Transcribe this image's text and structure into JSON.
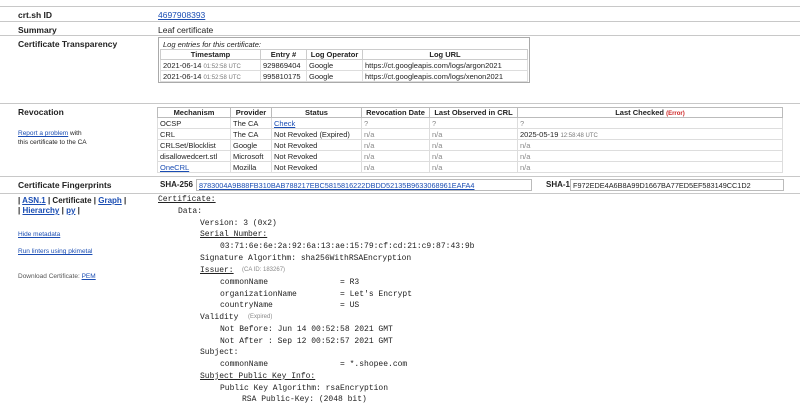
{
  "id_row": {
    "label": "crt.sh ID",
    "value": "4697908393"
  },
  "summary_row": {
    "label": "Summary",
    "value": "Leaf certificate"
  },
  "ct": {
    "label": "Certificate Transparency",
    "caption": "Log entries for this certificate:",
    "headers": [
      "Timestamp",
      "Entry #",
      "Log Operator",
      "Log URL"
    ],
    "rows": [
      {
        "date": "2021-06-14",
        "time": "01:52:58 UTC",
        "entry": "929869404",
        "operator": "Google",
        "url": "https://ct.googleapis.com/logs/argon2021"
      },
      {
        "date": "2021-06-14",
        "time": "01:52:58 UTC",
        "entry": "995810175",
        "operator": "Google",
        "url": "https://ct.googleapis.com/logs/xenon2021"
      }
    ]
  },
  "revocation": {
    "label": "Revocation",
    "report_link": "Report a problem",
    "report_rest": " with",
    "report_line2": "this certificate to the CA",
    "headers": [
      "Mechanism",
      "Provider",
      "Status",
      "Revocation Date",
      "Last Observed in CRL",
      "Last Checked"
    ],
    "error_tag": "(Error)",
    "rows": [
      {
        "mech": "OCSP",
        "prov": "The CA",
        "status": "Check",
        "rdate": "?",
        "lobs": "?",
        "lchk": "?",
        "ltime": ""
      },
      {
        "mech": "CRL",
        "prov": "The CA",
        "status": "Not Revoked (Expired)",
        "rdate": "n/a",
        "lobs": "n/a",
        "lchk": "2025-05-19",
        "ltime": "12:58:48 UTC"
      },
      {
        "mech": "CRLSet/Blocklist",
        "prov": "Google",
        "status": "Not Revoked",
        "rdate": "n/a",
        "lobs": "n/a",
        "lchk": "n/a",
        "ltime": ""
      },
      {
        "mech": "disallowedcert.stl",
        "prov": "Microsoft",
        "status": "Not Revoked",
        "rdate": "n/a",
        "lobs": "n/a",
        "lchk": "n/a",
        "ltime": ""
      },
      {
        "mech": "OneCRL",
        "prov": "Mozilla",
        "status": "Not Revoked",
        "rdate": "n/a",
        "lobs": "n/a",
        "lchk": "n/a",
        "ltime": ""
      }
    ]
  },
  "fingerprints": {
    "label": "Certificate Fingerprints",
    "sha256_label": "SHA-256",
    "sha256": "8783004A9B88FB310BAB788217EBC5815816222DBDD52135B9633068961EAFA4",
    "sha1_label": "SHA-1",
    "sha1": "F972EDE4A6B8A99D1667BA77ED5EF583149CC1D2"
  },
  "sidebar": {
    "asn1": "ASN.1",
    "certificate": "Certificate",
    "graph": "Graph",
    "hierarchy": "Hierarchy",
    "py": "py",
    "hide_metadata": "Hide metadata",
    "run_linters": "Run linters using pkimetal",
    "download_label": "Download Certificate:",
    "pem": "PEM"
  },
  "cert": {
    "certificate_link": "Certificate:",
    "data": "Data:",
    "version": "Version: 3 (0x2)",
    "serial_link": "Serial Number:",
    "serial": "03:71:6e:6e:2a:92:6a:13:ae:15:79:cf:cd:21:c9:87:43:9b",
    "sig_alg": "Signature Algorithm: sha256WithRSAEncryption",
    "issuer_link": "Issuer:",
    "issuer_caid": "(CA ID: 183267)",
    "issuer_cn": "commonName               = R3",
    "issuer_o": "organizationName         = Let's Encrypt",
    "issuer_c": "countryName              = US",
    "validity": "Validity",
    "expired": "(Expired)",
    "not_before": "Not Before: Jun 14 00:52:58 2021 GMT",
    "not_after": "Not After : Sep 12 00:52:57 2021 GMT",
    "subject": "Subject:",
    "subject_cn": "commonName               = *.shopee.com",
    "spki_link": "Subject Public Key Info:",
    "pk_alg": "Public Key Algorithm: rsaEncryption",
    "rsa": "RSA Public-Key: (2048 bit)"
  }
}
